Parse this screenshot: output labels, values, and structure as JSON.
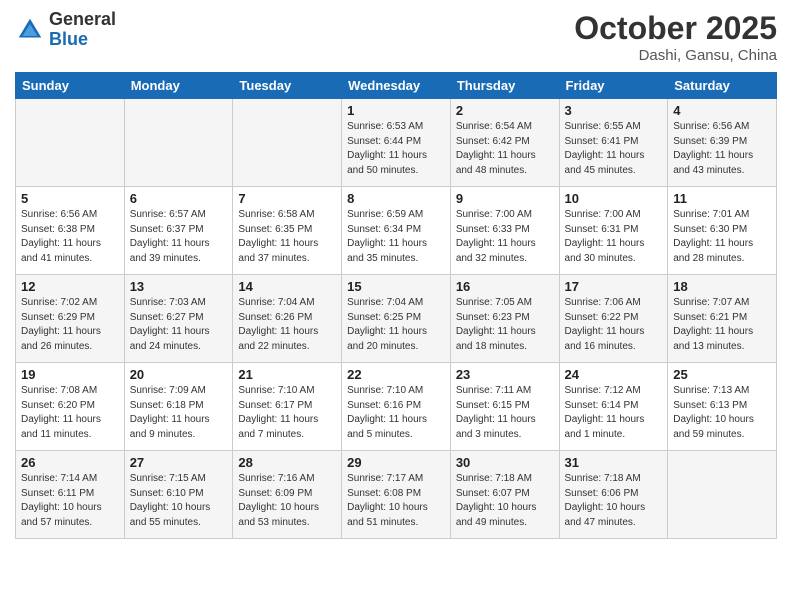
{
  "header": {
    "logo_general": "General",
    "logo_blue": "Blue",
    "month_title": "October 2025",
    "location": "Dashi, Gansu, China"
  },
  "days_of_week": [
    "Sunday",
    "Monday",
    "Tuesday",
    "Wednesday",
    "Thursday",
    "Friday",
    "Saturday"
  ],
  "weeks": [
    [
      {
        "day": "",
        "info": ""
      },
      {
        "day": "",
        "info": ""
      },
      {
        "day": "",
        "info": ""
      },
      {
        "day": "1",
        "info": "Sunrise: 6:53 AM\nSunset: 6:44 PM\nDaylight: 11 hours\nand 50 minutes."
      },
      {
        "day": "2",
        "info": "Sunrise: 6:54 AM\nSunset: 6:42 PM\nDaylight: 11 hours\nand 48 minutes."
      },
      {
        "day": "3",
        "info": "Sunrise: 6:55 AM\nSunset: 6:41 PM\nDaylight: 11 hours\nand 45 minutes."
      },
      {
        "day": "4",
        "info": "Sunrise: 6:56 AM\nSunset: 6:39 PM\nDaylight: 11 hours\nand 43 minutes."
      }
    ],
    [
      {
        "day": "5",
        "info": "Sunrise: 6:56 AM\nSunset: 6:38 PM\nDaylight: 11 hours\nand 41 minutes."
      },
      {
        "day": "6",
        "info": "Sunrise: 6:57 AM\nSunset: 6:37 PM\nDaylight: 11 hours\nand 39 minutes."
      },
      {
        "day": "7",
        "info": "Sunrise: 6:58 AM\nSunset: 6:35 PM\nDaylight: 11 hours\nand 37 minutes."
      },
      {
        "day": "8",
        "info": "Sunrise: 6:59 AM\nSunset: 6:34 PM\nDaylight: 11 hours\nand 35 minutes."
      },
      {
        "day": "9",
        "info": "Sunrise: 7:00 AM\nSunset: 6:33 PM\nDaylight: 11 hours\nand 32 minutes."
      },
      {
        "day": "10",
        "info": "Sunrise: 7:00 AM\nSunset: 6:31 PM\nDaylight: 11 hours\nand 30 minutes."
      },
      {
        "day": "11",
        "info": "Sunrise: 7:01 AM\nSunset: 6:30 PM\nDaylight: 11 hours\nand 28 minutes."
      }
    ],
    [
      {
        "day": "12",
        "info": "Sunrise: 7:02 AM\nSunset: 6:29 PM\nDaylight: 11 hours\nand 26 minutes."
      },
      {
        "day": "13",
        "info": "Sunrise: 7:03 AM\nSunset: 6:27 PM\nDaylight: 11 hours\nand 24 minutes."
      },
      {
        "day": "14",
        "info": "Sunrise: 7:04 AM\nSunset: 6:26 PM\nDaylight: 11 hours\nand 22 minutes."
      },
      {
        "day": "15",
        "info": "Sunrise: 7:04 AM\nSunset: 6:25 PM\nDaylight: 11 hours\nand 20 minutes."
      },
      {
        "day": "16",
        "info": "Sunrise: 7:05 AM\nSunset: 6:23 PM\nDaylight: 11 hours\nand 18 minutes."
      },
      {
        "day": "17",
        "info": "Sunrise: 7:06 AM\nSunset: 6:22 PM\nDaylight: 11 hours\nand 16 minutes."
      },
      {
        "day": "18",
        "info": "Sunrise: 7:07 AM\nSunset: 6:21 PM\nDaylight: 11 hours\nand 13 minutes."
      }
    ],
    [
      {
        "day": "19",
        "info": "Sunrise: 7:08 AM\nSunset: 6:20 PM\nDaylight: 11 hours\nand 11 minutes."
      },
      {
        "day": "20",
        "info": "Sunrise: 7:09 AM\nSunset: 6:18 PM\nDaylight: 11 hours\nand 9 minutes."
      },
      {
        "day": "21",
        "info": "Sunrise: 7:10 AM\nSunset: 6:17 PM\nDaylight: 11 hours\nand 7 minutes."
      },
      {
        "day": "22",
        "info": "Sunrise: 7:10 AM\nSunset: 6:16 PM\nDaylight: 11 hours\nand 5 minutes."
      },
      {
        "day": "23",
        "info": "Sunrise: 7:11 AM\nSunset: 6:15 PM\nDaylight: 11 hours\nand 3 minutes."
      },
      {
        "day": "24",
        "info": "Sunrise: 7:12 AM\nSunset: 6:14 PM\nDaylight: 11 hours\nand 1 minute."
      },
      {
        "day": "25",
        "info": "Sunrise: 7:13 AM\nSunset: 6:13 PM\nDaylight: 10 hours\nand 59 minutes."
      }
    ],
    [
      {
        "day": "26",
        "info": "Sunrise: 7:14 AM\nSunset: 6:11 PM\nDaylight: 10 hours\nand 57 minutes."
      },
      {
        "day": "27",
        "info": "Sunrise: 7:15 AM\nSunset: 6:10 PM\nDaylight: 10 hours\nand 55 minutes."
      },
      {
        "day": "28",
        "info": "Sunrise: 7:16 AM\nSunset: 6:09 PM\nDaylight: 10 hours\nand 53 minutes."
      },
      {
        "day": "29",
        "info": "Sunrise: 7:17 AM\nSunset: 6:08 PM\nDaylight: 10 hours\nand 51 minutes."
      },
      {
        "day": "30",
        "info": "Sunrise: 7:18 AM\nSunset: 6:07 PM\nDaylight: 10 hours\nand 49 minutes."
      },
      {
        "day": "31",
        "info": "Sunrise: 7:18 AM\nSunset: 6:06 PM\nDaylight: 10 hours\nand 47 minutes."
      },
      {
        "day": "",
        "info": ""
      }
    ]
  ]
}
